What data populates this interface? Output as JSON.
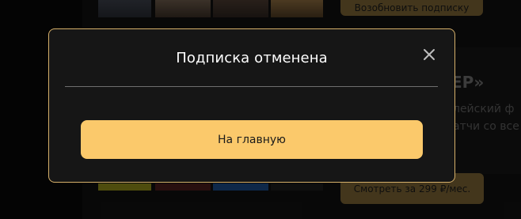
{
  "background": {
    "resume_button_label": "Возобновить подписку",
    "promo_title_fragment": "ЕР»",
    "promo_text_line1": "лейский ф",
    "promo_text_line2": "атчи со все",
    "watch_button_label": "Смотреть за 299 ₽/мес."
  },
  "modal": {
    "title": "Подписка отменена",
    "close_icon": "close-icon",
    "primary_button_label": "На главную"
  },
  "colors": {
    "accent": "#fbc96b",
    "modal_border": "#d6b06a",
    "modal_bg": "#161616"
  }
}
